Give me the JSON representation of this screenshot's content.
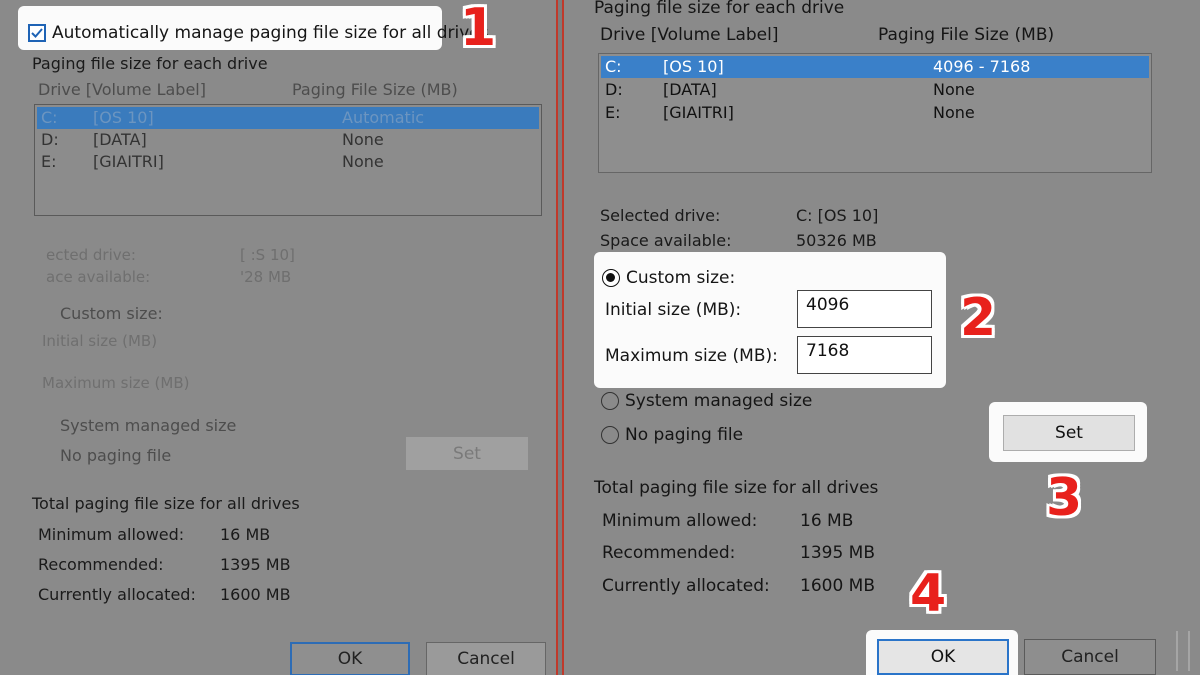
{
  "left": {
    "auto_manage_label": "Automatically manage paging file size for all drives",
    "auto_manage_checked": true,
    "section_title": "Paging file size for each drive",
    "col_drive": "Drive  [Volume Label]",
    "col_size": "Paging File Size (MB)",
    "drives": [
      {
        "drive": "C:",
        "label": "[OS 10]",
        "size": "Automatic"
      },
      {
        "drive": "D:",
        "label": "[DATA]",
        "size": "None"
      },
      {
        "drive": "E:",
        "label": "[GIAITRI]",
        "size": "None"
      }
    ],
    "selected_drive_label": "ected drive:",
    "selected_drive_value": "[ :S 10]",
    "space_label": "ace available:",
    "space_value": "'28 MB",
    "custom_size": "Custom size:",
    "initial_size": "Initial size (MB)",
    "maximum_size": "Maximum size (MB)",
    "system_managed": "System managed size",
    "no_paging": "No paging file",
    "set_button": "Set",
    "total_title": "Total paging file size for all drives",
    "min_label": "Minimum allowed:",
    "min_value": "16 MB",
    "rec_label": "Recommended:",
    "rec_value": "1395 MB",
    "cur_label": "Currently allocated:",
    "cur_value": "1600 MB",
    "ok_button": "OK",
    "cancel_button": "Cancel"
  },
  "right": {
    "section_title": "Paging file size for each drive",
    "col_drive": "Drive  [Volume Label]",
    "col_size": "Paging File Size (MB)",
    "drives": [
      {
        "drive": "C:",
        "label": "[OS 10]",
        "size": "4096 - 7168"
      },
      {
        "drive": "D:",
        "label": "[DATA]",
        "size": "None"
      },
      {
        "drive": "E:",
        "label": "[GIAITRI]",
        "size": "None"
      }
    ],
    "selected_drive_label": "Selected drive:",
    "selected_drive_value": "C:  [OS 10]",
    "space_label": "Space available:",
    "space_value": "50326 MB",
    "custom_size": "Custom size:",
    "initial_size": "Initial size (MB):",
    "initial_value": "4096",
    "maximum_size": "Maximum size (MB):",
    "maximum_value": "7168",
    "system_managed": "System managed size",
    "no_paging": "No paging file",
    "set_button": "Set",
    "total_title": "Total paging file size for all drives",
    "min_label": "Minimum allowed:",
    "min_value": "16 MB",
    "rec_label": "Recommended:",
    "rec_value": "1395 MB",
    "cur_label": "Currently allocated:",
    "cur_value": "1600 MB",
    "ok_button": "OK",
    "cancel_button": "Cancel"
  },
  "steps": [
    "1",
    "2",
    "3",
    "4"
  ],
  "colors": {
    "step_red": "#e8211c",
    "selection_blue": "#3a80c9",
    "divider_red": "#c0392b"
  }
}
